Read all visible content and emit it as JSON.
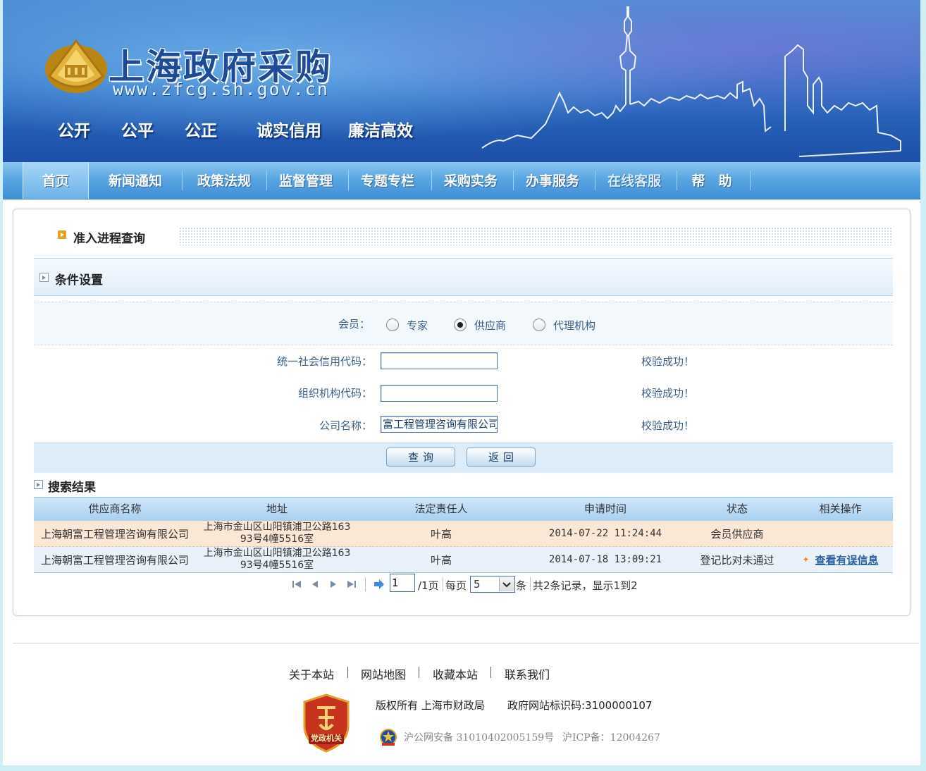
{
  "site": {
    "title": "上海政府采购",
    "url": "www.zfcg.sh.gov.cn",
    "mottos": [
      "公开",
      "公平",
      "公正",
      "诚实信用",
      "廉洁高效"
    ]
  },
  "nav": {
    "items": [
      "首页",
      "新闻通知",
      "政策法规",
      "监督管理",
      "专题专栏",
      "采购实务",
      "办事服务",
      "在线客服",
      "帮　助"
    ]
  },
  "query": {
    "section_title": "准入进程查询",
    "conditions_label": "条件设置",
    "member_label": "会员：",
    "member_options": [
      "专家",
      "供应商",
      "代理机构"
    ],
    "member_selected": "供应商",
    "fields": [
      {
        "label": "统一社会信用代码：",
        "value": "",
        "status": "校验成功！"
      },
      {
        "label": "组织机构代码：",
        "value": "",
        "status": "校验成功！"
      },
      {
        "label": "公司名称：",
        "value": "富工程管理咨询有限公司",
        "status": "校验成功！"
      }
    ],
    "query_button": "查询",
    "back_button": "返回"
  },
  "results": {
    "title": "搜索结果",
    "columns": [
      "供应商名称",
      "地址",
      "法定责任人",
      "申请时间",
      "状态",
      "相关操作"
    ],
    "rows": [
      {
        "name": "上海朝富工程管理咨询有限公司",
        "address_line1": "上海市金山区山阳镇浦卫公路163",
        "address_line2": "93号4幢5516室",
        "person": "叶高",
        "time": "2014-07-22 11:24:44",
        "status": "会员供应商",
        "action": ""
      },
      {
        "name": "上海朝富工程管理咨询有限公司",
        "address_line1": "上海市金山区山阳镇浦卫公路163",
        "address_line2": "93号4幢5516室",
        "person": "叶高",
        "time": "2014-07-18 13:09:21",
        "status": "登记比对未通过",
        "action": "查看有误信息"
      }
    ]
  },
  "pager": {
    "current_page": "1",
    "total_pages": "/1页",
    "per_page_label": "每页",
    "per_page": "5",
    "unit": "条",
    "summary": "共2条记录，显示1到2"
  },
  "footer": {
    "links": [
      "关于本站",
      "网站地图",
      "收藏本站",
      "联系我们"
    ],
    "copyright": "版权所有  上海市财政局",
    "gov_id": "政府网站标识码:3100000107",
    "badge_text": "党政机关",
    "police_record": "沪公网安备 31010402005159号",
    "icp": "沪ICP备：12004267"
  },
  "colors": {
    "nav_blue": "#4f9ee0",
    "link_blue": "#2c5ea2",
    "row_highlight": "#fbe7d6",
    "banner_dark": "#1d4fa8"
  }
}
